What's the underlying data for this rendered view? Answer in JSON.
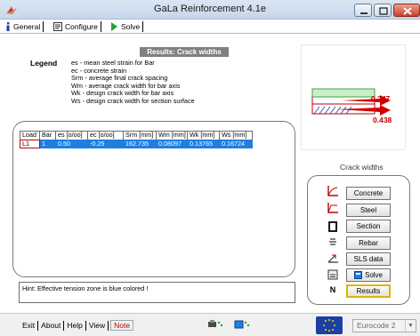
{
  "window": {
    "title": "GaLa Reinforcement 4.1e"
  },
  "tabs": [
    {
      "label": "General"
    },
    {
      "label": "Configure"
    },
    {
      "label": "Solve"
    }
  ],
  "section_title": "Results: Crack widths",
  "legend": {
    "title": "Legend",
    "lines": [
      "es  - mean steel strain for Bar",
      "ec  - concrete strain",
      "Srm - average final crack spacing",
      "Wm  - average crack width for bar axis",
      "Wk  - design crack width for bar axis",
      "Ws  - design crack width for section surface"
    ]
  },
  "diagram": {
    "label_top": "0.247",
    "label_bottom": "0.438"
  },
  "table": {
    "columns": [
      "Load",
      "Bar",
      "es [o/oo]",
      "ec [o/oo]",
      "Srm [mm]",
      "Wm [mm]",
      "Wk [mm]",
      "Ws [mm]"
    ],
    "rows": [
      [
        "L1",
        "1",
        "0.50",
        "-0.25",
        "162.735",
        "0.08097",
        "0.13765",
        "0.16724"
      ]
    ]
  },
  "hint": "Hint: Effective tension zone is blue colored !",
  "crack_widths": {
    "label": "Crack widths",
    "buttons": [
      "Concrete",
      "Steel",
      "Section",
      "Rebar",
      "SLS data",
      "Solve",
      "Results"
    ],
    "side_letter": "N"
  },
  "footer": {
    "menu": [
      "Exit",
      "About",
      "Help",
      "View",
      "Note"
    ],
    "standard": "Eurocode 2"
  },
  "colors": {
    "selection_blue": "#1e7fe0",
    "accent_red": "#c00000",
    "titlebar": "#c6d6ea"
  }
}
